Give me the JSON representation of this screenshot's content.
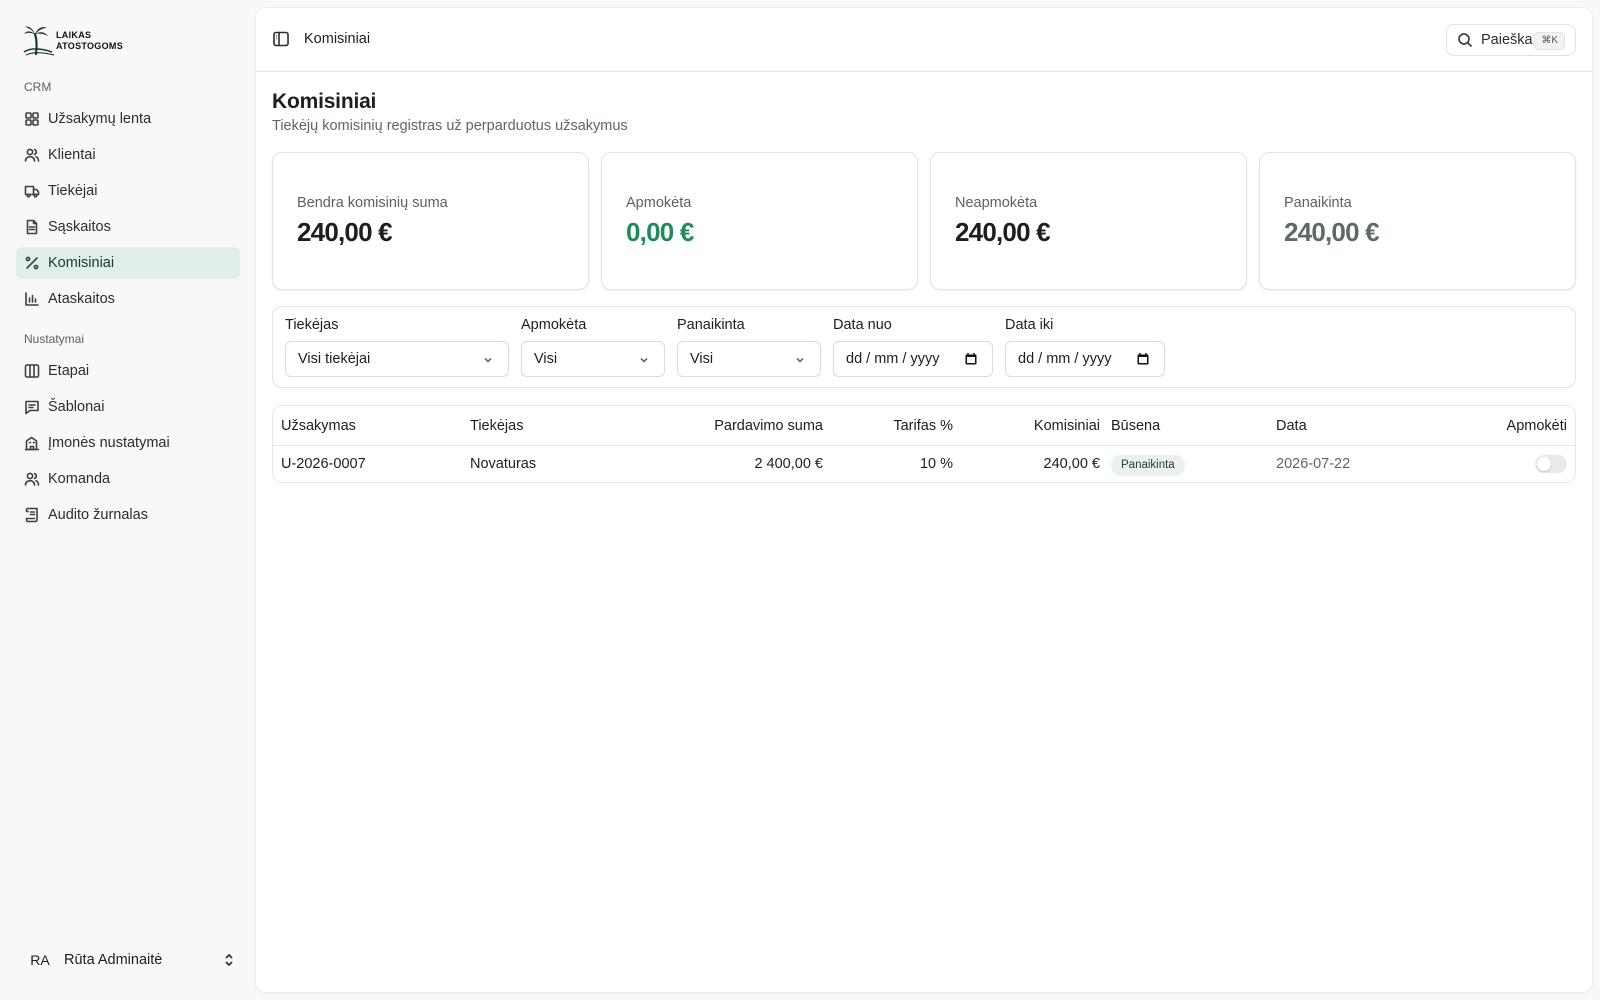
{
  "brand": {
    "line1": "LAIKAS",
    "line2": "ATOSTOGOMS"
  },
  "sidebar": {
    "section_crm": "CRM",
    "crm_items": [
      {
        "label": "Užsakymų lenta",
        "icon": "grid-icon"
      },
      {
        "label": "Klientai",
        "icon": "users-icon"
      },
      {
        "label": "Tiekėjai",
        "icon": "truck-icon"
      },
      {
        "label": "Sąskaitos",
        "icon": "file-icon"
      },
      {
        "label": "Komisiniai",
        "icon": "percent-icon",
        "active": true
      },
      {
        "label": "Ataskaitos",
        "icon": "bar-chart-icon"
      }
    ],
    "section_settings": "Nustatymai",
    "settings_items": [
      {
        "label": "Etapai",
        "icon": "columns-icon"
      },
      {
        "label": "Šablonai",
        "icon": "message-icon"
      },
      {
        "label": "Įmonės nustatymai",
        "icon": "building-icon"
      },
      {
        "label": "Komanda",
        "icon": "users-icon"
      },
      {
        "label": "Audito žurnalas",
        "icon": "log-icon"
      }
    ],
    "user": {
      "initials": "RA",
      "name": "Rūta Adminaitė"
    }
  },
  "topbar": {
    "breadcrumb": "Komisiniai",
    "search_label": "Paieška",
    "shortcut": "⌘K"
  },
  "page": {
    "title": "Komisiniai",
    "subtitle": "Tiekėjų komisinių registras už perparduotus užsakymus"
  },
  "stats": [
    {
      "label": "Bendra komisinių suma",
      "value": "240,00 €",
      "color": "#1c1f1d"
    },
    {
      "label": "Apmokėta",
      "value": "0,00 €",
      "color": "#1f8a5e"
    },
    {
      "label": "Neapmokėta",
      "value": "240,00 €",
      "color": "#1c1f1d"
    },
    {
      "label": "Panaikinta",
      "value": "240,00 €",
      "color": "#5f6a66"
    }
  ],
  "filters": {
    "supplier": {
      "label": "Tiekėjas",
      "value": "Visi tiekėjai"
    },
    "paid": {
      "label": "Apmokėta",
      "value": "Visi"
    },
    "cancelled": {
      "label": "Panaikinta",
      "value": "Visi"
    },
    "date_from": {
      "label": "Data nuo",
      "placeholder": "dd / mm / yyyy"
    },
    "date_to": {
      "label": "Data iki",
      "placeholder": "dd / mm / yyyy"
    }
  },
  "table": {
    "headers": [
      "Užsakymas",
      "Tiekėjas",
      "Pardavimo suma",
      "Tarifas %",
      "Komisiniai",
      "Būsena",
      "Data",
      "Apmokėti"
    ],
    "rows": [
      {
        "order": "U-2026-0007",
        "supplier": "Novaturas",
        "sale": "2 400,00 €",
        "rate": "10 %",
        "commission": "240,00 €",
        "status": "Panaikinta",
        "date": "2026-07-22",
        "paid": false
      }
    ]
  },
  "colors": {
    "accent": "#1f8a5e",
    "active_bg": "#e0efea"
  }
}
